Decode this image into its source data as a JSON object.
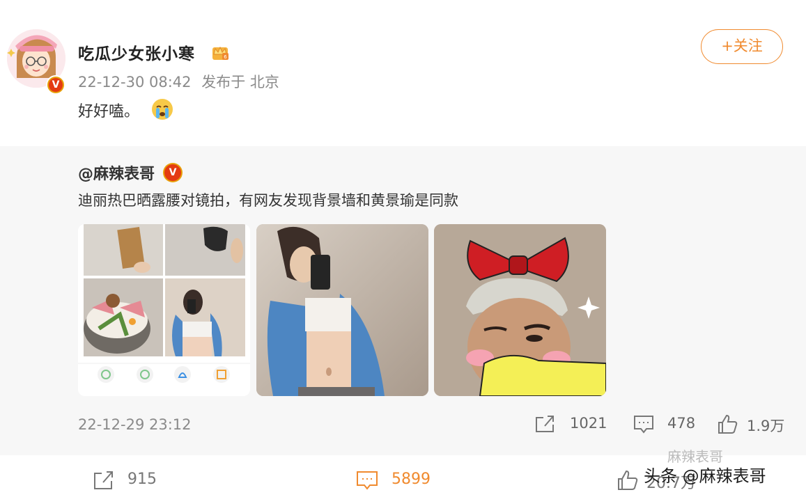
{
  "post": {
    "username": "吃瓜少女张小寒",
    "verified_badge": "V",
    "crown_icon": "crown-icon",
    "date": "22-12-30 08:42",
    "location": "发布于 北京",
    "content": "好好嗑。",
    "emoji_icon": "crying-emoji-icon",
    "follow_label": "+关注"
  },
  "repost": {
    "username": "@麻辣表哥",
    "verified_badge": "V",
    "text": "迪丽热巴晒露腰对镜拍，有网友发现背景墙和黄景瑜是同款",
    "images": [
      "collage-image",
      "mirror-selfie-image",
      "bow-selfie-image"
    ],
    "date": "22-12-29 23:12",
    "share_count": "1021",
    "comment_count": "478",
    "like_count": "1.9万"
  },
  "actions": {
    "share_count": "915",
    "comment_count": "5899",
    "like_count": "20.7万"
  },
  "watermark": {
    "text": "头条 @麻辣表哥",
    "faint_text": "麻辣表哥"
  },
  "colors": {
    "accent": "#f08a2e",
    "verified_red": "#e43b12",
    "verified_gold": "#e8a10a"
  }
}
